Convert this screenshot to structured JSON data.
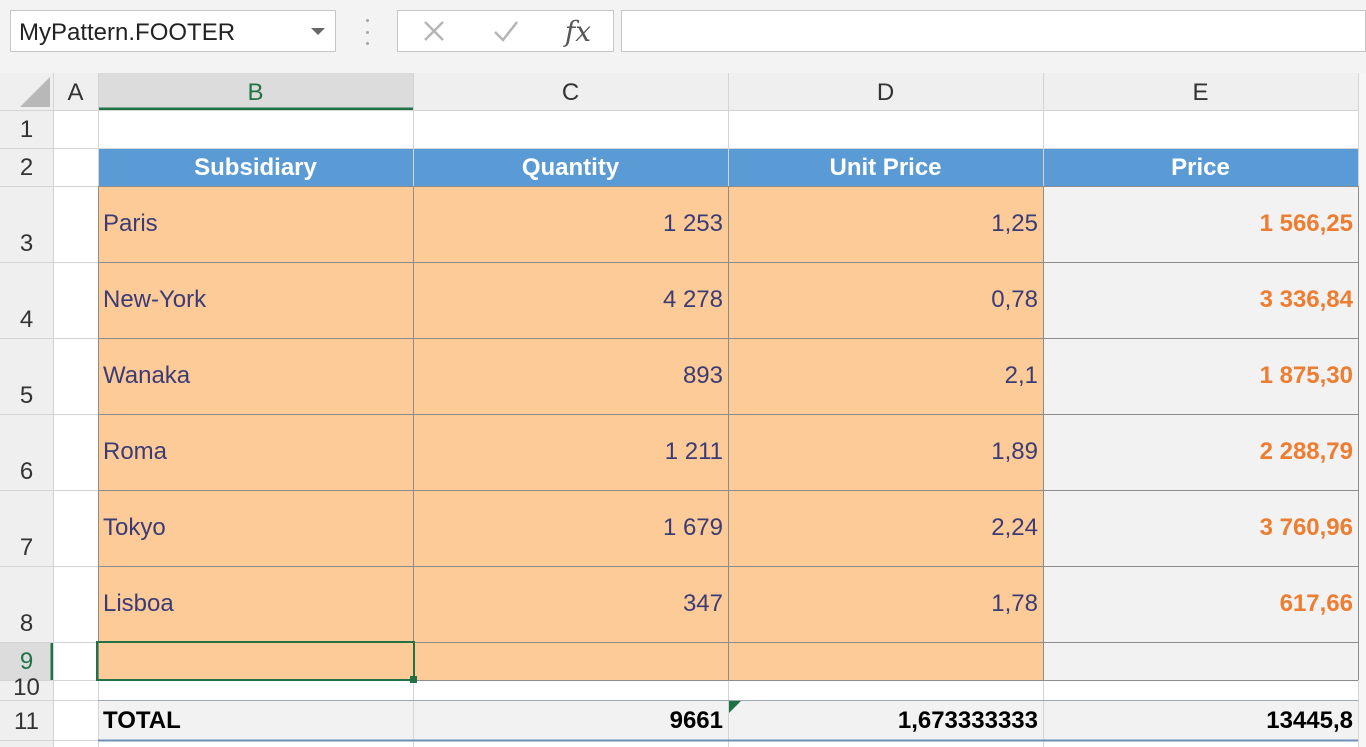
{
  "name_box": {
    "value": "MyPattern.FOOTER"
  },
  "formula_bar": {
    "cancel_icon": "close-x-icon",
    "enter_icon": "checkmark-icon",
    "function_label": "fx",
    "formula_value": ""
  },
  "columns": [
    "A",
    "B",
    "C",
    "D",
    "E"
  ],
  "rows": [
    "1",
    "2",
    "3",
    "4",
    "5",
    "6",
    "7",
    "8",
    "9",
    "10",
    "11"
  ],
  "active_cell": {
    "column": "B",
    "row": "9"
  },
  "table": {
    "headers": [
      "Subsidiary",
      "Quantity",
      "Unit Price",
      "Price"
    ],
    "data_rows": [
      [
        "Paris",
        "1 253",
        "1,25",
        "1 566,25"
      ],
      [
        "New-York",
        "4 278",
        "0,78",
        "3 336,84"
      ],
      [
        "Wanaka",
        "893",
        "2,1",
        "1 875,30"
      ],
      [
        "Roma",
        "1 211",
        "1,89",
        "2 288,79"
      ],
      [
        "Tokyo",
        "1 679",
        "2,24",
        "3 760,96"
      ],
      [
        "Lisboa",
        "347",
        "1,78",
        "617,66"
      ]
    ],
    "total_row": [
      "TOTAL",
      "9661",
      "1,673333333",
      "13445,8"
    ]
  },
  "colors": {
    "header_fill": "#5b9bd5",
    "data_fill": "#fdcb98",
    "price_fill": "#f2f2f2",
    "price_text": "#ed7d31",
    "data_text": "#3b3b76",
    "selection": "#217346",
    "gridline": "#d4d4d4",
    "cell_border": "#8c8c8c"
  }
}
